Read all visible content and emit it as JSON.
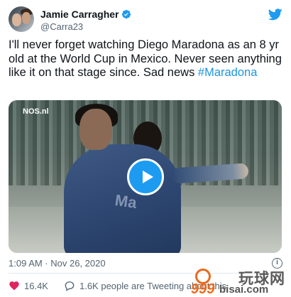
{
  "author": {
    "display_name": "Jamie Carragher",
    "handle": "@Carra23",
    "verified": true
  },
  "tweet": {
    "text": "I'll never forget watching Diego Maradona as an 8 yr old at the World Cup in Mexico. Never seen anything like it on that stage since. Sad news ",
    "hashtag": "#Maradona"
  },
  "media": {
    "type": "video",
    "channel_logo": "NOS.nl",
    "shirt_text": "Ma"
  },
  "timestamp": "1:09 AM · Nov 26, 2020",
  "footer": {
    "like_count": "16.4K",
    "people_tweeting": "1.6K people are Tweeting about this"
  },
  "watermark": {
    "chinese": "玩球网",
    "number": "999",
    "site": "bisai.com"
  },
  "colors": {
    "accent": "#1d9bf0",
    "hashtag": "#1b95e0",
    "text_secondary": "#536471",
    "like_red": "#e0245e"
  },
  "icons": {
    "header_right": "twitter-bird-icon",
    "verified": "verified-badge-icon",
    "play": "play-icon",
    "info": "info-icon",
    "like": "heart-icon",
    "conversation": "reply-bubble-icon"
  }
}
